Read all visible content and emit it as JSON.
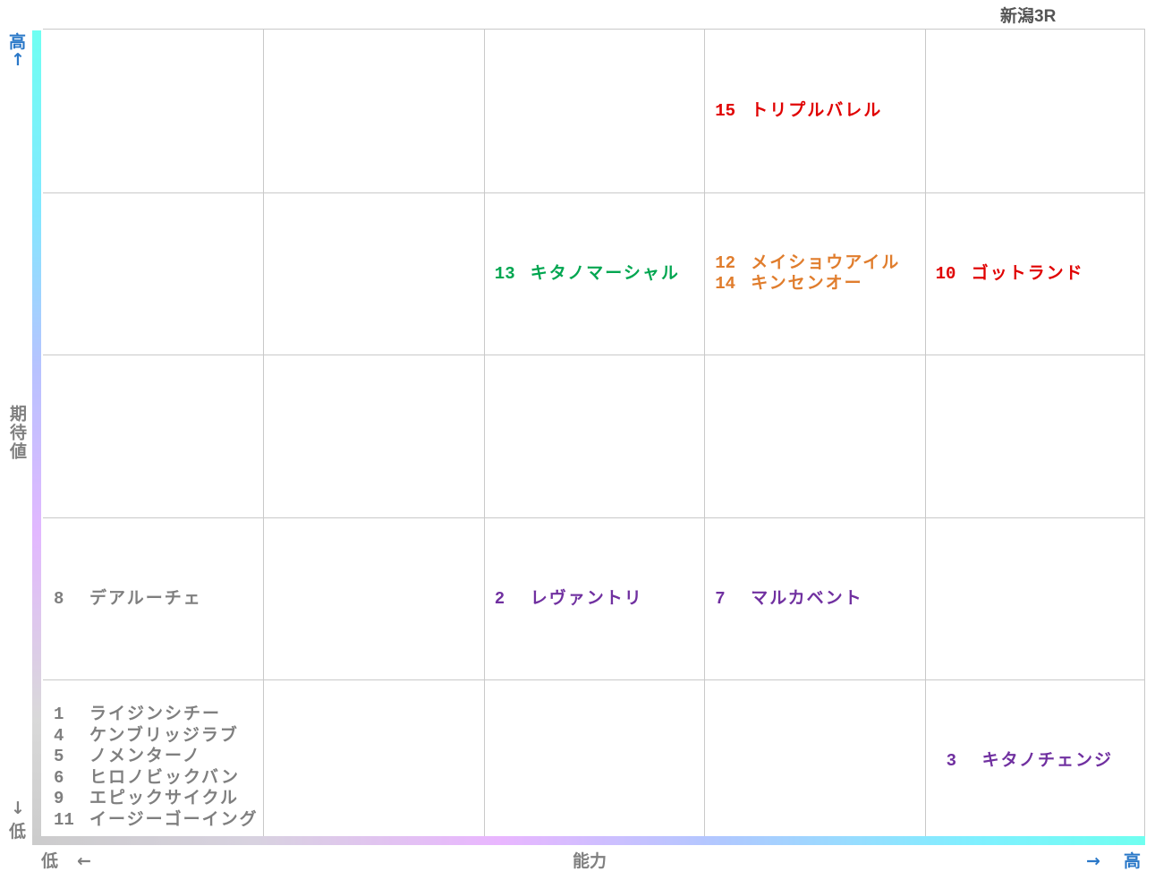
{
  "title": "新潟3R",
  "chart_data": {
    "type": "scatter",
    "xlabel": "能力",
    "ylabel": "期待値",
    "x_low": "低",
    "x_high": "高",
    "y_low": "低",
    "y_high": "高",
    "arrow_left": "←",
    "arrow_right": "→",
    "arrow_up": "↑",
    "arrow_down": "↓",
    "cols": 5,
    "rows": 5,
    "colors": {
      "gray": "#7f7f7f",
      "purple": "#7030a0",
      "orange": "#e07d2d",
      "green": "#00a650",
      "red": "#e00000"
    },
    "groups": [
      {
        "col": 0,
        "row": 0,
        "color": "gray",
        "items": [
          {
            "num": "1",
            "name": "ライジンシチー"
          },
          {
            "num": "4",
            "name": "ケンブリッジラブ"
          },
          {
            "num": "5",
            "name": "ノメンターノ"
          },
          {
            "num": "6",
            "name": "ヒロノビックバン"
          },
          {
            "num": "9",
            "name": "エピックサイクル"
          },
          {
            "num": "11",
            "name": "イージーゴーイング"
          }
        ]
      },
      {
        "col": 0,
        "row": 1,
        "color": "gray",
        "items": [
          {
            "num": "8",
            "name": "デアルーチェ"
          }
        ]
      },
      {
        "col": 2,
        "row": 1,
        "color": "purple",
        "items": [
          {
            "num": "2",
            "name": "レヴァントリ"
          }
        ]
      },
      {
        "col": 3,
        "row": 1,
        "color": "purple",
        "items": [
          {
            "num": "7",
            "name": "マルカベント"
          }
        ]
      },
      {
        "col": 4,
        "row": 0,
        "color": "purple",
        "items": [
          {
            "num": "3",
            "name": "キタノチェンジ"
          }
        ]
      },
      {
        "col": 2,
        "row": 3,
        "color": "green",
        "items": [
          {
            "num": "13",
            "name": "キタノマーシャル"
          }
        ]
      },
      {
        "col": 3,
        "row": 3,
        "color": "orange",
        "items": [
          {
            "num": "12",
            "name": "メイショウアイル"
          },
          {
            "num": "14",
            "name": "キンセンオー"
          }
        ]
      },
      {
        "col": 4,
        "row": 3,
        "color": "red",
        "items": [
          {
            "num": "10",
            "name": "ゴットランド"
          }
        ]
      },
      {
        "col": 3,
        "row": 4,
        "color": "red",
        "items": [
          {
            "num": "15",
            "name": "トリプルバレル"
          }
        ]
      }
    ]
  }
}
